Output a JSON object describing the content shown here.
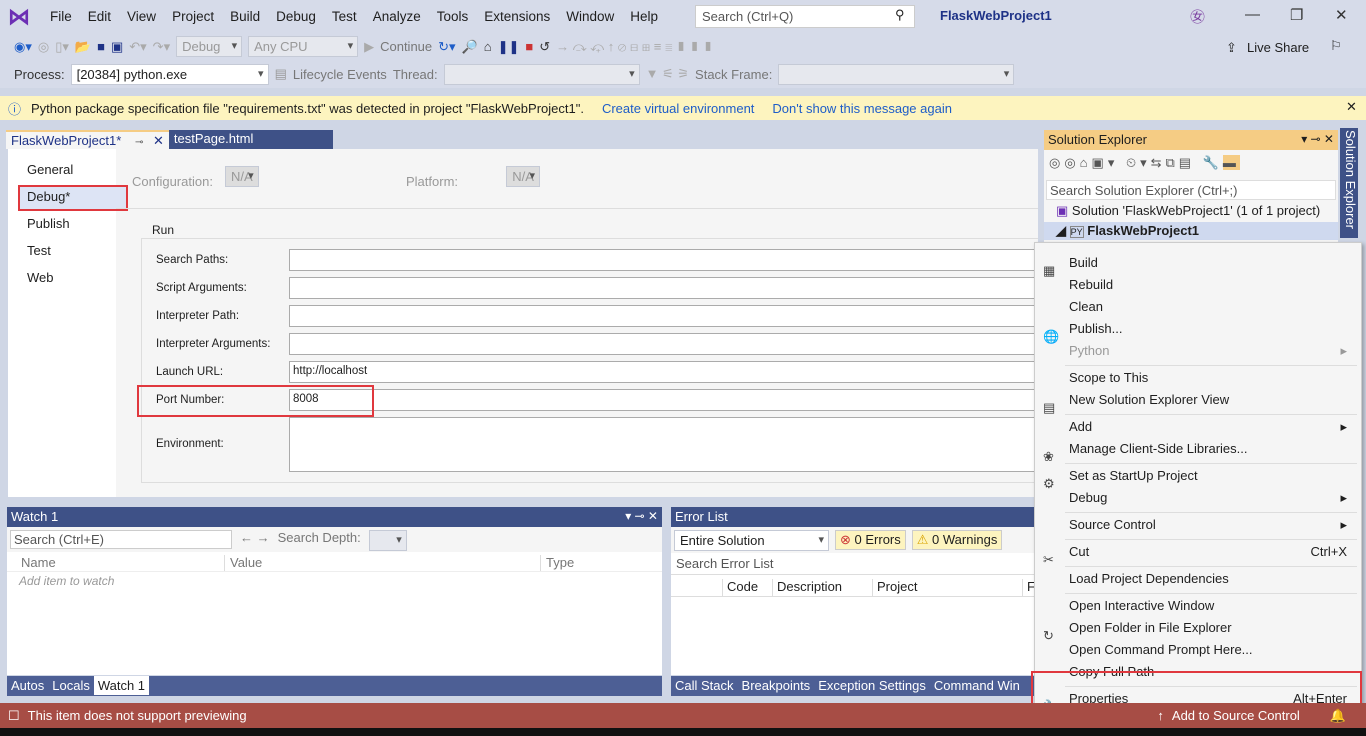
{
  "menu": [
    "File",
    "Edit",
    "View",
    "Project",
    "Build",
    "Debug",
    "Test",
    "Analyze",
    "Tools",
    "Extensions",
    "Window",
    "Help"
  ],
  "search_placeholder": "Search (Ctrl+Q)",
  "window_title": "FlaskWebProject1",
  "toolbar": {
    "config": "Debug",
    "platform": "Any CPU",
    "continue": "Continue",
    "live_share": "Live Share"
  },
  "toolbar2": {
    "process_label": "Process:",
    "process": "[20384] python.exe",
    "lifecycle": "Lifecycle Events",
    "thread": "Thread:",
    "stack_frame": "Stack Frame:"
  },
  "infobar": {
    "message": "Python package specification file \"requirements.txt\" was detected in project \"FlaskWebProject1\".",
    "link1": "Create virtual environment",
    "link2": "Don't show this message again"
  },
  "tabs": [
    {
      "label": "FlaskWebProject1*"
    },
    {
      "label": "testPage.html"
    }
  ],
  "nav": [
    "General",
    "Debug*",
    "Publish",
    "Test",
    "Web"
  ],
  "config": {
    "configuration_label": "Configuration:",
    "configuration": "N/A",
    "platform_label": "Platform:",
    "platform": "N/A",
    "section": "Run"
  },
  "fields": [
    {
      "label": "Search Paths:",
      "value": ""
    },
    {
      "label": "Script Arguments:",
      "value": ""
    },
    {
      "label": "Interpreter Path:",
      "value": ""
    },
    {
      "label": "Interpreter Arguments:",
      "value": ""
    },
    {
      "label": "Launch URL:",
      "value": "http://localhost"
    },
    {
      "label": "Port Number:",
      "value": "8008"
    },
    {
      "label": "Environment:",
      "value": ""
    }
  ],
  "watch": {
    "title": "Watch 1",
    "search": "Search (Ctrl+E)",
    "depth": "Search Depth:",
    "cols": [
      "Name",
      "Value",
      "Type"
    ],
    "placeholder": "Add item to watch",
    "tabs": [
      "Autos",
      "Locals",
      "Watch 1"
    ]
  },
  "errors": {
    "title": "Error List",
    "scope": "Entire Solution",
    "errors": "0 Errors",
    "warnings": "0 Warnings",
    "search": "Search Error List",
    "cols": [
      "Code",
      "Description",
      "Project",
      "F"
    ],
    "tabs": [
      "Call Stack",
      "Breakpoints",
      "Exception Settings",
      "Command Win"
    ]
  },
  "solution_explorer": {
    "title": "Solution Explorer",
    "search": "Search Solution Explorer (Ctrl+;)",
    "solution": "Solution 'FlaskWebProject1' (1 of 1 project)",
    "project": "FlaskWebProject1",
    "side_tab": "Solution Explorer"
  },
  "context_menu": [
    {
      "label": "Build",
      "icon": "build-icon"
    },
    {
      "label": "Rebuild"
    },
    {
      "label": "Clean"
    },
    {
      "label": "Publish...",
      "icon": "globe-icon"
    },
    {
      "label": "Python",
      "disabled": true,
      "submenu": true
    },
    {
      "label": "Scope to This"
    },
    {
      "label": "New Solution Explorer View",
      "icon": "window-icon"
    },
    {
      "label": "Add",
      "submenu": true
    },
    {
      "label": "Manage Client-Side Libraries...",
      "icon": "library-icon"
    },
    {
      "label": "Set as StartUp Project",
      "icon": "gear-icon"
    },
    {
      "label": "Debug",
      "submenu": true
    },
    {
      "label": "Source Control",
      "submenu": true
    },
    {
      "label": "Cut",
      "shortcut": "Ctrl+X",
      "icon": "cut-icon"
    },
    {
      "label": "Load Project Dependencies"
    },
    {
      "label": "Open Interactive Window"
    },
    {
      "label": "Open Folder in File Explorer",
      "icon": "refresh-icon"
    },
    {
      "label": "Open Command Prompt Here..."
    },
    {
      "label": "Copy Full Path"
    },
    {
      "label": "Properties",
      "shortcut": "Alt+Enter",
      "icon": "wrench-icon"
    }
  ],
  "status": {
    "message": "This item does not support previewing",
    "source_control": "Add to Source Control"
  },
  "colors": {
    "accent": "#3e5187",
    "status": "#a74d45",
    "highlight": "#e0383e"
  }
}
